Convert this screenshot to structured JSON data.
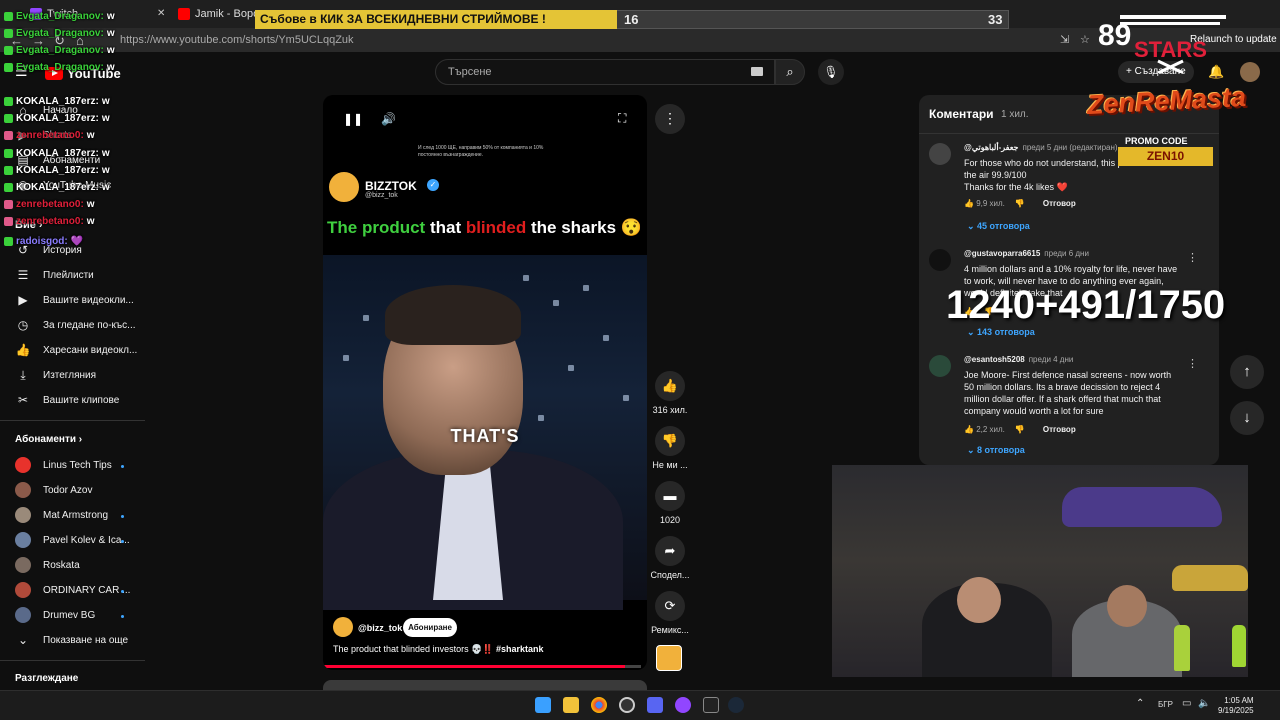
{
  "browser": {
    "tabs": [
      {
        "label": "Twitch"
      },
      {
        "label": "Jamik - Вороны (..."
      }
    ],
    "url": "https://www.youtube.com/shorts/Ym5UCLqqZuk",
    "relaunch_label": "Relaunch to update"
  },
  "overlay": {
    "banner_text": "Събове в КИК ЗА ВСЕКИДНЕВНИ СТРИЙМОВЕ !",
    "banner_left_value": "16",
    "banner_right_value": "33",
    "banner_progress": 0.48,
    "stars_number": "89",
    "stars_text": "STARS",
    "zen_logo": "ZenReMasta",
    "promo_label": "PROMO CODE",
    "promo_code": "ZEN10",
    "counter": "1240+491/1750"
  },
  "chat": [
    {
      "user": "Evgata_Draganov:",
      "msg": "w",
      "color": "#3ad13a"
    },
    {
      "user": "Evgata_Draganov:",
      "msg": "w",
      "color": "#3ad13a"
    },
    {
      "user": "Evgata_Draganov:",
      "msg": "w",
      "color": "#3ad13a"
    },
    {
      "user": "Evgata_Draganov:",
      "msg": "w",
      "color": "#3ad13a"
    },
    {
      "user": "KOKALA_187erz:",
      "msg": "w",
      "color": "#ffffff"
    },
    {
      "user": "KOKALA_187erz:",
      "msg": "w",
      "color": "#ffffff"
    },
    {
      "user": "zenrebetano0:",
      "msg": "w",
      "color": "#e0203a"
    },
    {
      "user": "KOKALA_187erz:",
      "msg": "w",
      "color": "#ffffff"
    },
    {
      "user": "KOKALA_187erz:",
      "msg": "w",
      "color": "#ffffff"
    },
    {
      "user": "KOKALA_187erz:",
      "msg": "w",
      "color": "#ffffff"
    },
    {
      "user": "zenrebetano0:",
      "msg": "w",
      "color": "#e0203a"
    },
    {
      "user": "zenrebetano0:",
      "msg": "w",
      "color": "#e0203a"
    },
    {
      "user": "radoisgod:",
      "msg": "💜",
      "color": "#8a7cff"
    }
  ],
  "youtube": {
    "logo": "YouTube",
    "search_placeholder": "Търсене",
    "create_label": "Създаване"
  },
  "sidebar": {
    "items": [
      {
        "label": "Начало",
        "icon": "⌂",
        "name": "sidebar-item-home"
      },
      {
        "label": "Shorts",
        "icon": "▶",
        "name": "sidebar-item-shorts"
      },
      {
        "label": "Абонаменти",
        "icon": "▤",
        "name": "sidebar-item-subscriptions"
      },
      {
        "label": "YouTube Music",
        "icon": "◉",
        "name": "sidebar-item-music"
      }
    ],
    "you_label": "Вие",
    "you_items": [
      {
        "label": "История",
        "icon": "↺",
        "name": "sidebar-item-history"
      },
      {
        "label": "Плейлисти",
        "icon": "☰",
        "name": "sidebar-item-playlists"
      },
      {
        "label": "Вашите видеокли...",
        "icon": "▶",
        "name": "sidebar-item-your-videos"
      },
      {
        "label": "За гледане по-къс...",
        "icon": "◷",
        "name": "sidebar-item-watch-later"
      },
      {
        "label": "Харесани видеокл...",
        "icon": "👍",
        "name": "sidebar-item-liked"
      },
      {
        "label": "Изтегляния",
        "icon": "⤓",
        "name": "sidebar-item-downloads"
      },
      {
        "label": "Вашите клипове",
        "icon": "✂",
        "name": "sidebar-item-clips"
      }
    ],
    "subs_label": "Абонаменти",
    "subs": [
      {
        "label": "Linus Tech Tips",
        "color": "#e8322c",
        "dot": true
      },
      {
        "label": "Todor Azov",
        "color": "#8b5a4a",
        "dot": false
      },
      {
        "label": "Mat Armstrong",
        "color": "#9a8a7a",
        "dot": true
      },
      {
        "label": "Pavel Kolev & Ica...",
        "color": "#6a7fa0",
        "dot": true
      },
      {
        "label": "Roskata",
        "color": "#7a6a60",
        "dot": false
      },
      {
        "label": "ORDINARY CAR ...",
        "color": "#b04a3a",
        "dot": true
      },
      {
        "label": "Drumev BG",
        "color": "#5a6a8a",
        "dot": true
      }
    ],
    "show_more": "Показване на още",
    "explore_label": "Разглеждане"
  },
  "short": {
    "top_text": "И след 1000 ЩЕ, направим 50% от компанията и 10% постоянно възнаграждение.",
    "channel_name": "BIZZTOK",
    "channel_handle": "@bizz_tok",
    "hook_part1": "The product",
    "hook_part2": " that ",
    "hook_part3": "blinded",
    "hook_part4": " the sharks 😯‼️",
    "caption_word": "THAT'S",
    "sub_handle": "@bizz_tok",
    "subscribe_label": "Абониране",
    "description": "The product that blinded investors 💀‼️",
    "hashtag": "#sharktank",
    "progress": 0.95
  },
  "actions": {
    "likes": "316 хил.",
    "dislike": "Не ми ...",
    "comments": "1020",
    "share": "Сподел...",
    "remix": "Ремикс..."
  },
  "comments": {
    "title": "Коментари",
    "count": "1 хил.",
    "items": [
      {
        "author": "@جعفر-ألباهوتي",
        "time": "преди 5 дни (редактиран)",
        "text": "For those who do not understand, this pa... is till the the air 99.9/100\nThanks for the 4k likes ❤️",
        "likes": "9,9 хил.",
        "replies": "45 отговора",
        "avatar_color": "#444"
      },
      {
        "author": "@gustavoparra6615",
        "time": "преди 6 дни",
        "text": "4 million dollars and a 10% royalty for life, never have to work, will never have to do anything ever again, would definitely take that",
        "likes": "",
        "replies": "143 отговора",
        "avatar_color": "#111"
      },
      {
        "author": "@esantosh5208",
        "time": "преди 4 дни",
        "text": "Joe Moore- First defence nasal screens - now worth 50 million dollars. Its a brave decission to reject 4 million dollar offer. If a shark offerd that much that company would worth a lot for sure",
        "likes": "2,2 хил.",
        "replies": "8 отговора",
        "avatar_color": "#2a4a3a"
      }
    ],
    "reply_label": "Отговор"
  },
  "taskbar": {
    "lang": "БГР",
    "time": "1:05 AM",
    "date": "9/19/2025"
  }
}
